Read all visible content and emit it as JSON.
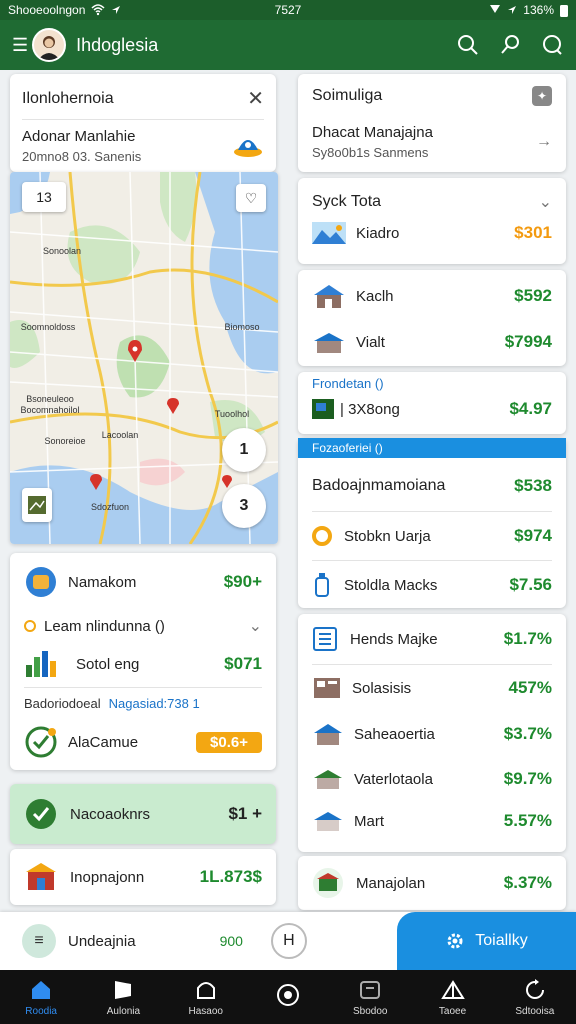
{
  "status_bar": {
    "carrier": "Shooeoolngon",
    "time": "7527",
    "battery": "136%"
  },
  "app_bar": {
    "title": "Ihdoglesia",
    "avatar": "avatar",
    "actions": [
      "search-icon",
      "magnify-icon",
      "refresh-icon"
    ]
  },
  "left": {
    "search_card": {
      "title": "Ilonlohernoia",
      "name": "Adonar Manlahie",
      "detail": "20mno8 03. Sanenis"
    },
    "map": {
      "zoom_label": "13",
      "places": [
        "Sonoolan",
        "Soomnoldoss",
        "Bsoneuleoo",
        "Bocomnahoilol",
        "Tuoolhol",
        "Biomoso",
        "Lacoolan",
        "Sonoreioe",
        "Sdozfuon"
      ],
      "zoom_in": "1",
      "zoom_out": "3"
    },
    "summary_card": {
      "item1": {
        "label": "Namakom",
        "price": "$90+"
      },
      "dropdown": "Leam nlindunna ()",
      "item2": {
        "label": "Sotol eng",
        "price": "$071"
      },
      "row_label": "Badoriodoeal",
      "row_link": "Nagasiad:738 1",
      "item3": {
        "label": "AlaCamue",
        "badge": "$0.6+"
      }
    },
    "green_card": {
      "label": "Nacoaoknrs",
      "value": "$1 +"
    },
    "bottom_card": {
      "label": "Inopnajonn",
      "value": "1L.873$"
    }
  },
  "right": {
    "card1": {
      "title": "Soimuliga",
      "name": "Dhacat Manajajna",
      "detail": "Sy8o0b1s Sanmens"
    },
    "card2": {
      "title": "Syck Tota",
      "item": {
        "label": "Kiadro",
        "price": "$301"
      }
    },
    "card3": {
      "items": [
        {
          "label": "Kaclh",
          "price": "$592"
        },
        {
          "label": "Vialt",
          "price": "$7994"
        }
      ]
    },
    "card4": {
      "title": "Frondetan ()",
      "item": {
        "label": "| 3X8ong",
        "price": "$4.97"
      }
    },
    "card5": {
      "header": "Fozaoferiei ()",
      "title": "Badoajnmamoiana",
      "title_price": "$538",
      "items": [
        {
          "label": "Stobkn Uarja",
          "price": "$974"
        },
        {
          "label": "Stoldla Macks",
          "price": "$7.56"
        }
      ]
    },
    "card6": {
      "items": [
        {
          "label": "Hends Majke",
          "price": "$1.7%"
        },
        {
          "label": "Solasisis",
          "price": "457%"
        },
        {
          "label": "Saheaoertia",
          "price": "$3.7%"
        },
        {
          "label": "Vaterlotaola",
          "price": "$9.7%"
        },
        {
          "label": "Mart",
          "price": "5.57%"
        }
      ]
    },
    "card7": {
      "label": "Manajolan",
      "price": "$.37%"
    }
  },
  "bottom_bar": {
    "label": "Undeajnia",
    "value": "900",
    "button": "H",
    "cta": "Toiallky"
  },
  "nav": [
    {
      "label": "Roodia",
      "icon": "home-icon"
    },
    {
      "label": "Aulonia",
      "icon": "flag-icon"
    },
    {
      "label": "Hasaoo",
      "icon": "building-icon"
    },
    {
      "label": "",
      "icon": "circle-icon"
    },
    {
      "label": "Sbodoo",
      "icon": "inbox-icon"
    },
    {
      "label": "Taoee",
      "icon": "tent-icon"
    },
    {
      "label": "Sdtooisa",
      "icon": "refresh-icon"
    }
  ],
  "colors": {
    "app_bar": "#1f6b33",
    "accent": "#1a8fe0",
    "price_green": "#1e8a2e",
    "price_orange": "#f39a0f"
  }
}
